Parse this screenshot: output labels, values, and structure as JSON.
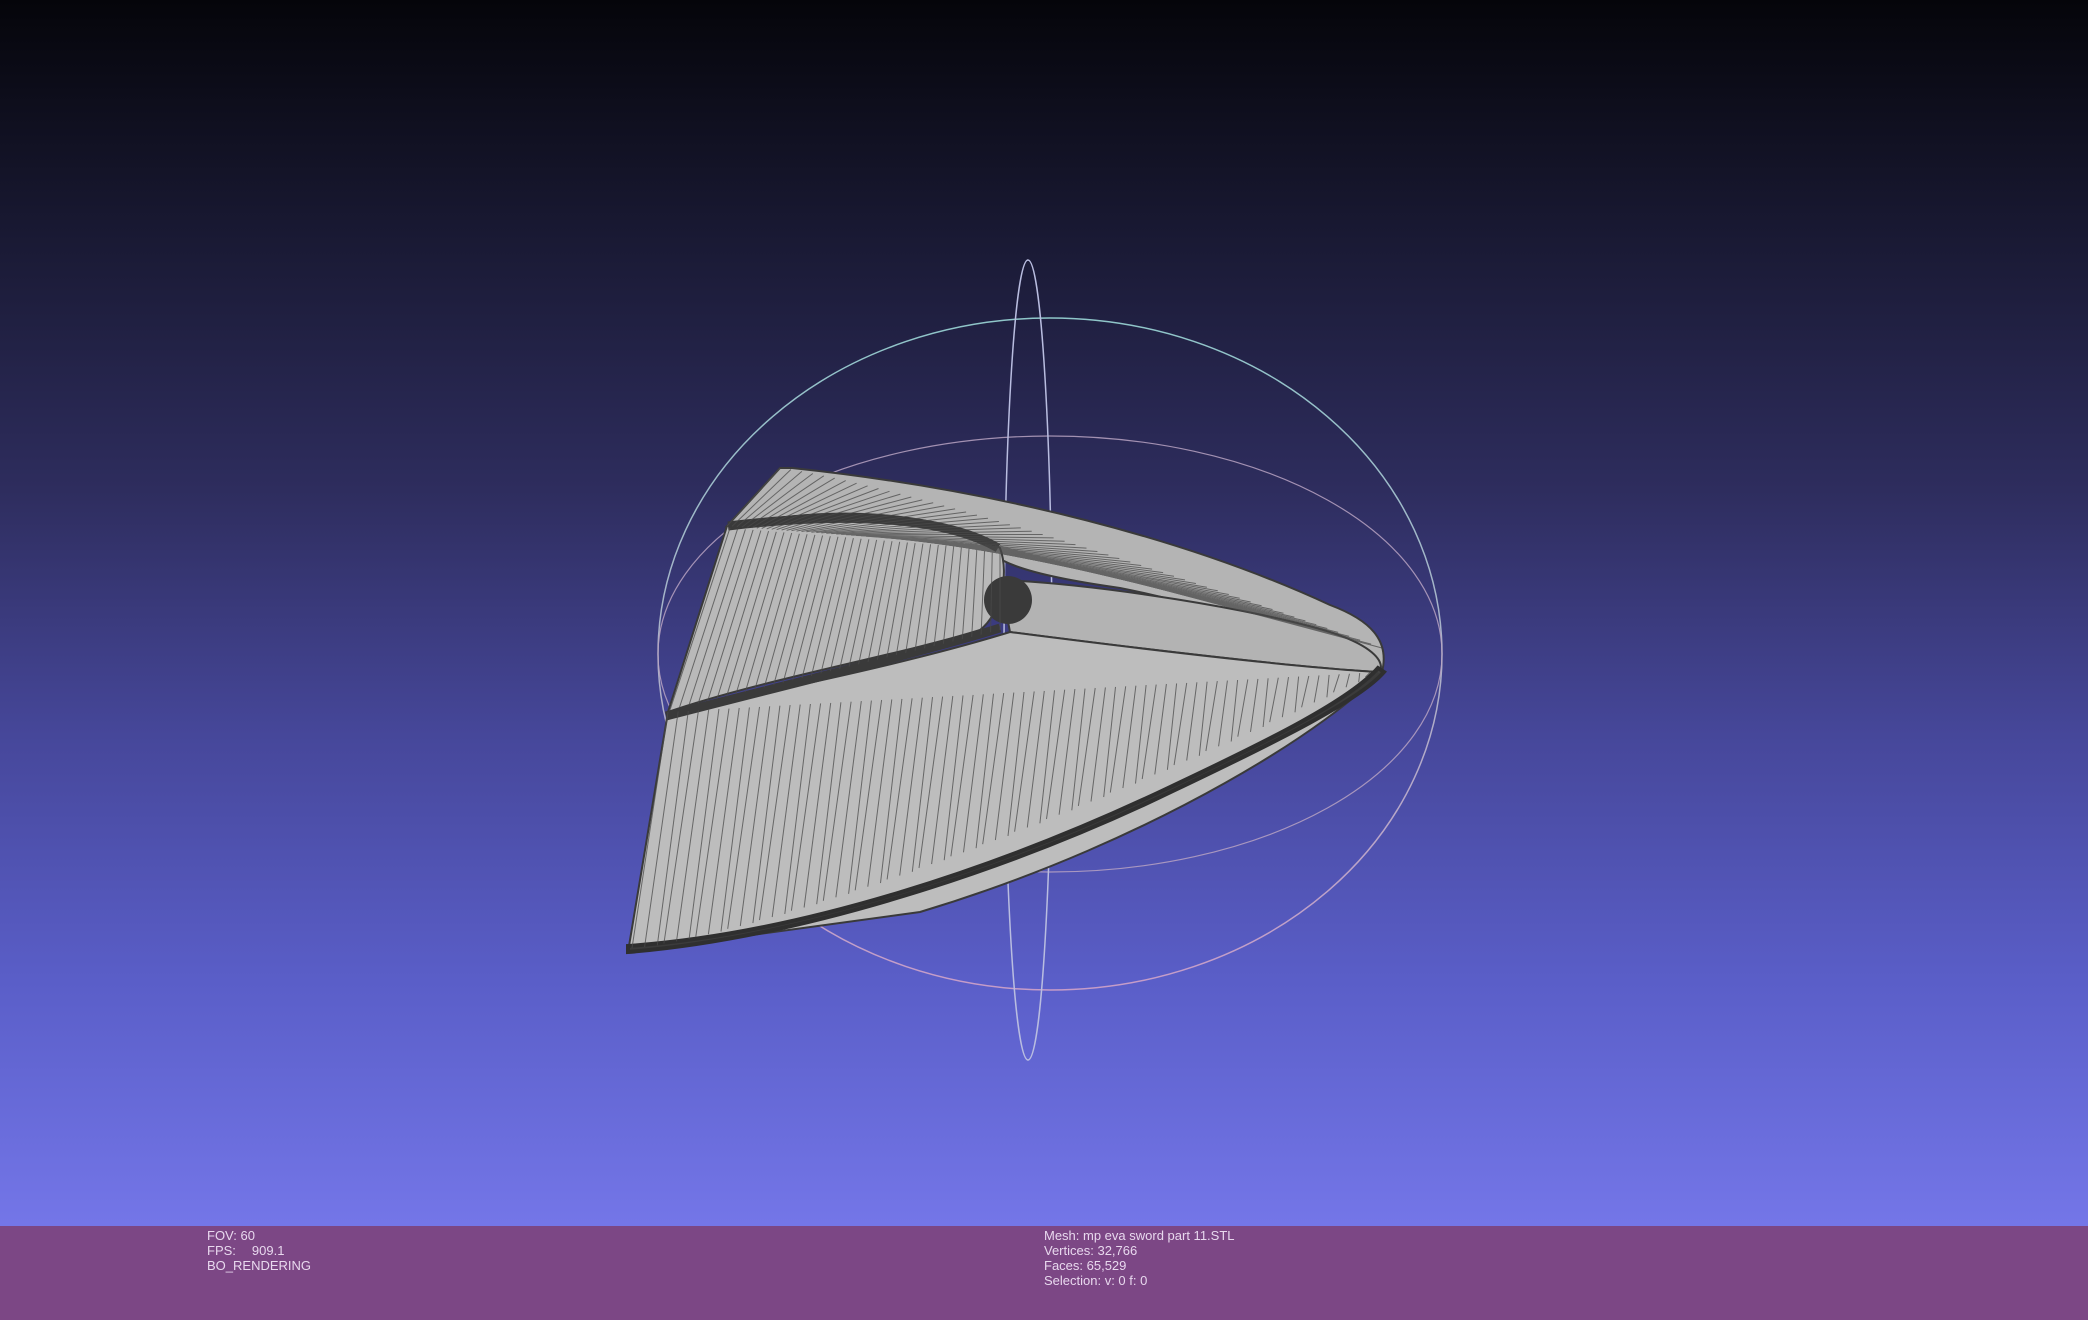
{
  "viewer": {
    "trackball_colors": {
      "horizontal_ring": "#8fc6c9",
      "vertical_ring": "#b9bde0",
      "tilted_ring": "#b8a3c2"
    },
    "mesh_colors": {
      "fill": "#b7b7b7",
      "wire": "#3c3c3c",
      "edge": "#3a3a3a"
    }
  },
  "info_left": {
    "fov": "FOV: 60",
    "fps_label": "FPS:",
    "fps_value": "909.1",
    "render_mode": "BO_RENDERING"
  },
  "info_right": {
    "mesh": "Mesh: mp eva sword part 11.STL",
    "vertices": "Vertices: 32,766",
    "faces": "Faces: 65,529",
    "selection": "Selection: v: 0 f: 0"
  }
}
